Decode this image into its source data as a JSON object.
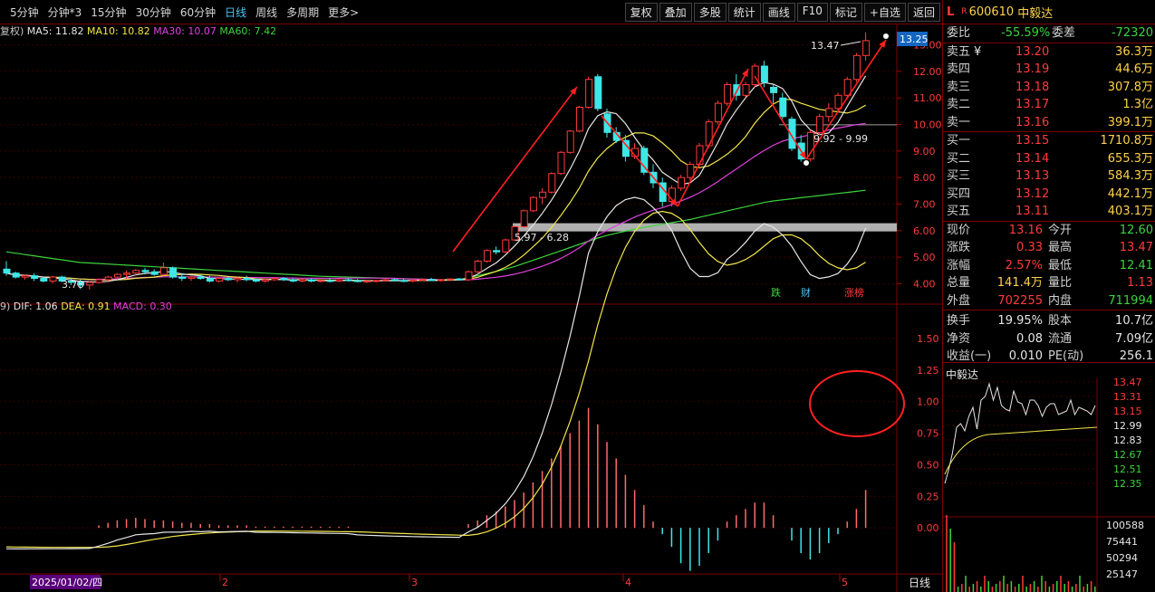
{
  "toolbar": {
    "periods": [
      "5分钟",
      "分钟*3",
      "15分钟",
      "30分钟",
      "60分钟",
      "日线",
      "周线",
      "多周期",
      "更多>"
    ],
    "active_period": "日线",
    "buttons": [
      "复权",
      "叠加",
      "多股",
      "统计",
      "画线",
      "F10",
      "标记",
      "+自选",
      "返回"
    ]
  },
  "ma_legend": {
    "prefix": "复权)",
    "items": [
      {
        "label": "MA5: 11.82",
        "color": "#e6e6e6"
      },
      {
        "label": "MA10: 10.82",
        "color": "#f2e64a"
      },
      {
        "label": "MA30: 10.07",
        "color": "#e040e0"
      },
      {
        "label": "MA60: 7.42",
        "color": "#3cd33c"
      }
    ]
  },
  "macd_legend": {
    "prefix": "9)",
    "items": [
      {
        "label": "DIF: 1.06",
        "color": "#e6e6e6"
      },
      {
        "label": "DEA: 0.91",
        "color": "#f2e64a"
      },
      {
        "label": "MACD: 0.30",
        "color": "#e040e0"
      }
    ]
  },
  "price_axis": [
    "13.00",
    "12.00",
    "11.00",
    "10.00",
    "9.00",
    "8.00",
    "7.00",
    "6.00",
    "5.00",
    "4.00"
  ],
  "current_price_tag": "13.25",
  "annotations": {
    "high_label": "13.47",
    "low_label": "3.78",
    "zone1_label": "5.97 - 6.28",
    "zone2_label": "9.92 - 9.99",
    "badge_die": "跌",
    "badge_cai": "财",
    "badge_zhangbang": "涨榜"
  },
  "macd_axis": [
    "1.50",
    "1.25",
    "1.00",
    "0.75",
    "0.50",
    "0.25",
    "0.00"
  ],
  "date_axis": {
    "first": "2025/01/02/四",
    "ticks": [
      "2",
      "3",
      "4",
      "5"
    ],
    "right_label": "日线"
  },
  "stock": {
    "code": "600610",
    "name": "中毅达",
    "flag_l": "L",
    "flag_r": "R"
  },
  "quote_header": {
    "weibi_label": "委比",
    "weibi": "-55.59%",
    "weicha_label": "委差",
    "weicha": "-72320"
  },
  "asks": [
    {
      "label": "卖五",
      "mark": "¥",
      "price": "13.20",
      "vol": "36.3万"
    },
    {
      "label": "卖四",
      "mark": "",
      "price": "13.19",
      "vol": "44.6万"
    },
    {
      "label": "卖三",
      "mark": "",
      "price": "13.18",
      "vol": "307.8万"
    },
    {
      "label": "卖二",
      "mark": "",
      "price": "13.17",
      "vol": "1.3亿"
    },
    {
      "label": "卖一",
      "mark": "",
      "price": "13.16",
      "vol": "399.1万"
    }
  ],
  "bids": [
    {
      "label": "买一",
      "price": "13.15",
      "vol": "1710.8万"
    },
    {
      "label": "买二",
      "price": "13.14",
      "vol": "655.3万"
    },
    {
      "label": "买三",
      "price": "13.13",
      "vol": "584.3万"
    },
    {
      "label": "买四",
      "price": "13.12",
      "vol": "442.1万"
    },
    {
      "label": "买五",
      "price": "13.11",
      "vol": "403.1万"
    }
  ],
  "stats": [
    {
      "l1": "现价",
      "v1": "13.16",
      "c1": "red",
      "l2": "今开",
      "v2": "12.60",
      "c2": "green"
    },
    {
      "l1": "涨跌",
      "v1": "0.33",
      "c1": "red",
      "l2": "最高",
      "v2": "13.47",
      "c2": "red"
    },
    {
      "l1": "涨幅",
      "v1": "2.57%",
      "c1": "red",
      "l2": "最低",
      "v2": "12.41",
      "c2": "green"
    },
    {
      "l1": "总量",
      "v1": "141.4万",
      "c1": "yellow",
      "l2": "量比",
      "v2": "1.13",
      "c2": "red"
    },
    {
      "l1": "外盘",
      "v1": "702255",
      "c1": "red",
      "l2": "内盘",
      "v2": "711994",
      "c2": "green"
    }
  ],
  "stats2": [
    {
      "l1": "换手",
      "v1": "19.95%",
      "l2": "股本",
      "v2": "10.7亿"
    },
    {
      "l1": "净资",
      "v1": "0.08",
      "l2": "流通",
      "v2": "7.09亿"
    },
    {
      "l1": "收益(一)",
      "v1": "0.010",
      "l2": "PE(动)",
      "v2": "256.1"
    }
  ],
  "mini_chart": {
    "title": "中毅达",
    "price_axis": [
      {
        "v": "13.47",
        "c": "red"
      },
      {
        "v": "13.31",
        "c": "red"
      },
      {
        "v": "13.15",
        "c": "red"
      },
      {
        "v": "12.99",
        "c": "white"
      },
      {
        "v": "12.83",
        "c": "white"
      },
      {
        "v": "12.67",
        "c": "green"
      },
      {
        "v": "12.51",
        "c": "green"
      },
      {
        "v": "12.35",
        "c": "green"
      }
    ],
    "vol_axis": [
      "100588",
      "75441",
      "50294",
      "25147"
    ]
  },
  "chart_data": {
    "type": "candlestick",
    "candles": [
      [
        4.55,
        4.85,
        4.3,
        4.4
      ],
      [
        4.4,
        4.45,
        4.2,
        4.25
      ],
      [
        4.25,
        4.35,
        4.15,
        4.3
      ],
      [
        4.3,
        4.4,
        4.1,
        4.2
      ],
      [
        4.2,
        4.25,
        4.05,
        4.1
      ],
      [
        4.1,
        4.3,
        4.0,
        4.25
      ],
      [
        4.25,
        4.3,
        4.05,
        4.1
      ],
      [
        4.1,
        4.2,
        3.95,
        4.05
      ],
      [
        4.05,
        4.15,
        3.8,
        3.95
      ],
      [
        3.95,
        4.1,
        3.78,
        4.05
      ],
      [
        4.05,
        4.2,
        4.0,
        4.15
      ],
      [
        4.15,
        4.3,
        4.05,
        4.25
      ],
      [
        4.25,
        4.4,
        4.15,
        4.35
      ],
      [
        4.35,
        4.5,
        4.2,
        4.4
      ],
      [
        4.4,
        4.55,
        4.3,
        4.5
      ],
      [
        4.5,
        4.6,
        4.35,
        4.45
      ],
      [
        4.45,
        4.55,
        4.3,
        4.35
      ],
      [
        4.35,
        4.8,
        4.3,
        4.6
      ],
      [
        4.6,
        4.65,
        4.2,
        4.25
      ],
      [
        4.25,
        4.4,
        4.1,
        4.2
      ],
      [
        4.2,
        4.3,
        4.1,
        4.25
      ],
      [
        4.25,
        4.35,
        4.15,
        4.2
      ],
      [
        4.2,
        4.3,
        4.05,
        4.1
      ],
      [
        4.1,
        4.25,
        4.05,
        4.2
      ],
      [
        4.2,
        4.25,
        4.1,
        4.15
      ],
      [
        4.15,
        4.25,
        4.05,
        4.2
      ],
      [
        4.2,
        4.3,
        4.1,
        4.15
      ],
      [
        4.15,
        4.2,
        4.05,
        4.1
      ],
      [
        4.1,
        4.2,
        4.05,
        4.15
      ],
      [
        4.15,
        4.25,
        4.1,
        4.2
      ],
      [
        4.2,
        4.25,
        4.1,
        4.15
      ],
      [
        4.15,
        4.2,
        4.05,
        4.1
      ],
      [
        4.1,
        4.2,
        4.05,
        4.15
      ],
      [
        4.15,
        4.2,
        4.05,
        4.1
      ],
      [
        4.1,
        4.15,
        4.05,
        4.12
      ],
      [
        4.12,
        4.2,
        4.05,
        4.1
      ],
      [
        4.1,
        4.18,
        4.05,
        4.15
      ],
      [
        4.15,
        4.2,
        4.08,
        4.12
      ],
      [
        4.12,
        4.18,
        4.05,
        4.08
      ],
      [
        4.08,
        4.15,
        4.02,
        4.1
      ],
      [
        4.1,
        4.15,
        4.05,
        4.12
      ],
      [
        4.12,
        4.18,
        4.08,
        4.15
      ],
      [
        4.15,
        4.2,
        4.1,
        4.12
      ],
      [
        4.12,
        4.18,
        4.06,
        4.1
      ],
      [
        4.1,
        4.16,
        4.05,
        4.14
      ],
      [
        4.14,
        4.2,
        4.1,
        4.16
      ],
      [
        4.16,
        4.22,
        4.1,
        4.12
      ],
      [
        4.12,
        4.18,
        4.08,
        4.15
      ],
      [
        4.15,
        4.2,
        4.1,
        4.18
      ],
      [
        4.18,
        4.22,
        4.12,
        4.15
      ],
      [
        4.15,
        4.5,
        4.1,
        4.45
      ],
      [
        4.45,
        4.9,
        4.4,
        4.85
      ],
      [
        4.85,
        5.3,
        4.8,
        5.25
      ],
      [
        5.25,
        5.4,
        5.1,
        5.2
      ],
      [
        5.2,
        5.7,
        5.15,
        5.65
      ],
      [
        5.65,
        6.2,
        5.6,
        6.15
      ],
      [
        6.15,
        6.8,
        6.1,
        6.75
      ],
      [
        6.75,
        7.3,
        6.7,
        7.25
      ],
      [
        7.25,
        7.6,
        7.0,
        7.45
      ],
      [
        7.45,
        8.2,
        7.4,
        8.15
      ],
      [
        8.15,
        9.0,
        8.1,
        8.95
      ],
      [
        8.95,
        9.8,
        8.9,
        9.75
      ],
      [
        9.75,
        10.7,
        9.7,
        10.65
      ],
      [
        10.65,
        11.8,
        10.6,
        11.7
      ],
      [
        11.8,
        11.9,
        10.5,
        10.6
      ],
      [
        10.4,
        10.6,
        9.5,
        9.7
      ],
      [
        9.7,
        9.9,
        9.3,
        9.4
      ],
      [
        9.4,
        9.6,
        8.6,
        8.8
      ],
      [
        8.8,
        9.3,
        8.7,
        9.1
      ],
      [
        9.1,
        9.2,
        8.1,
        8.2
      ],
      [
        8.2,
        8.5,
        7.6,
        7.8
      ],
      [
        7.8,
        8.0,
        6.9,
        7.1
      ],
      [
        7.1,
        7.7,
        6.9,
        7.6
      ],
      [
        7.6,
        8.1,
        7.5,
        8.0
      ],
      [
        8.0,
        8.6,
        7.9,
        8.5
      ],
      [
        8.5,
        9.3,
        8.4,
        9.2
      ],
      [
        9.2,
        10.2,
        9.1,
        10.1
      ],
      [
        10.1,
        10.9,
        10.0,
        10.8
      ],
      [
        10.8,
        11.6,
        10.7,
        11.5
      ],
      [
        11.5,
        11.9,
        10.9,
        11.1
      ],
      [
        11.1,
        11.6,
        11.0,
        11.5
      ],
      [
        11.5,
        12.3,
        11.4,
        12.2
      ],
      [
        12.2,
        12.4,
        11.4,
        11.6
      ],
      [
        11.4,
        11.5,
        10.8,
        11.2
      ],
      [
        11.0,
        11.2,
        10.2,
        10.3
      ],
      [
        10.2,
        10.3,
        9.0,
        9.1
      ],
      [
        9.3,
        9.6,
        8.6,
        8.7
      ],
      [
        8.7,
        9.8,
        8.6,
        9.7
      ],
      [
        9.7,
        10.4,
        9.6,
        10.3
      ],
      [
        10.3,
        10.8,
        10.1,
        10.6
      ],
      [
        10.6,
        11.2,
        10.5,
        11.1
      ],
      [
        11.1,
        11.8,
        11.0,
        11.7
      ],
      [
        11.7,
        12.7,
        11.6,
        12.6
      ],
      [
        12.6,
        13.47,
        12.41,
        13.16
      ]
    ],
    "ma60": [
      5.2,
      5.15,
      5.1,
      5.05,
      5.0,
      4.95,
      4.9,
      4.85,
      4.8,
      4.78,
      4.76,
      4.74,
      4.72,
      4.7,
      4.68,
      4.66,
      4.64,
      4.62,
      4.6,
      4.58,
      4.56,
      4.54,
      4.52,
      4.5,
      4.48,
      4.46,
      4.44,
      4.42,
      4.4,
      4.38,
      4.36,
      4.34,
      4.32,
      4.3,
      4.28,
      4.27,
      4.26,
      4.25,
      4.24,
      4.23,
      4.22,
      4.21,
      4.2,
      4.19,
      4.18,
      4.17,
      4.16,
      4.15,
      4.15,
      4.15,
      4.22,
      4.3,
      4.38,
      4.46,
      4.55,
      4.65,
      4.76,
      4.88,
      5.0,
      5.12,
      5.24,
      5.36,
      5.48,
      5.6,
      5.72,
      5.82,
      5.9,
      5.98,
      6.06,
      6.12,
      6.18,
      6.24,
      6.3,
      6.36,
      6.42,
      6.5,
      6.58,
      6.66,
      6.74,
      6.82,
      6.9,
      6.98,
      7.06,
      7.12,
      7.16,
      7.2,
      7.24,
      7.28,
      7.32,
      7.36,
      7.4,
      7.44,
      7.48,
      7.52
    ],
    "macd": {
      "dif_dea_range": [
        -0.35,
        1.7
      ],
      "hist": [
        0.0,
        0.0,
        0.0,
        0.0,
        0.0,
        0.0,
        0.0,
        0.0,
        0.0,
        0.0,
        0.02,
        0.04,
        0.06,
        0.07,
        0.08,
        0.07,
        0.06,
        0.06,
        0.05,
        0.04,
        0.04,
        0.03,
        0.03,
        0.02,
        0.02,
        0.02,
        0.02,
        0.01,
        0.01,
        0.01,
        0.01,
        0.01,
        0.01,
        0.01,
        0.01,
        0.01,
        0.01,
        0.01,
        0.0,
        0.0,
        0.0,
        0.0,
        0.0,
        0.0,
        0.0,
        0.0,
        0.0,
        0.0,
        0.0,
        0.0,
        0.03,
        0.06,
        0.1,
        0.13,
        0.17,
        0.22,
        0.28,
        0.36,
        0.45,
        0.55,
        0.65,
        0.75,
        0.85,
        0.95,
        0.82,
        0.68,
        0.55,
        0.42,
        0.3,
        0.18,
        0.05,
        -0.05,
        -0.15,
        -0.28,
        -0.34,
        -0.3,
        -0.2,
        -0.1,
        0.05,
        0.1,
        0.15,
        0.2,
        0.2,
        0.1,
        0.0,
        -0.1,
        -0.2,
        -0.25,
        -0.2,
        -0.12,
        -0.05,
        0.05,
        0.15,
        0.3
      ]
    }
  }
}
